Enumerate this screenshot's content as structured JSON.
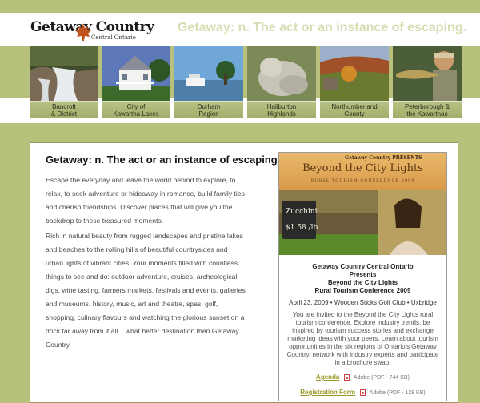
{
  "header": {
    "logo_name": "Getaway Country",
    "logo_sub": "Central Ontario",
    "tagline": "Getaway: n. The act or an instance of escaping."
  },
  "regions": [
    {
      "line1": "Bancroft",
      "line2": "& District"
    },
    {
      "line1": "City of",
      "line2": "Kawartha Lakes"
    },
    {
      "line1": "Durham",
      "line2": "Region"
    },
    {
      "line1": "Haliburton",
      "line2": "Highlands"
    },
    {
      "line1": "Northumberland",
      "line2": "County"
    },
    {
      "line1": "Peterborough &",
      "line2": "the Kawarthas"
    }
  ],
  "main": {
    "heading": "Getaway: n. The act or an instance of escaping.",
    "para1": "Escape the everyday and leave the world behind to explore, to relax, to seek adventure or hideaway in romance, build family ties and cherish friendships. Discover places that will give you the backdrop to these treasured moments.",
    "para2": "Rich in natural beauty from rugged landscapes and pristine lakes and beaches to the rolling hills of beautiful countrysides and urban lights of vibrant cities. Your moments filled with countless things to see and do: outdoor adventure, cruises, archeological digs, wine tasting, farmers markets, festivals and events, galleries and museums, history, music, art and theatre, spas, golf, shopping, culinary flavours and watching the glorious sunset on a dock far away from it all... what better destination then Getaway Country."
  },
  "promo": {
    "banner_logo": "Getaway Country",
    "banner_presents": "PRESENTS",
    "banner_title": "Beyond the City Lights",
    "banner_sub": "RURAL TOURISM CONFERENCE 2009",
    "photo_sign": "Zucchini",
    "photo_price": "$1.58 /lb",
    "title_lines": [
      "Getaway Country Central Ontario",
      "Presents",
      "Beyond the City Lights",
      "Rural Tourism Conference 2009"
    ],
    "meta": "April 23, 2009 • Wooden Sticks Golf Club • Uxbridge",
    "body": "You are invited to the Beyond the City Lights rural tourism conference. Explore industry trends, be inspired by tourism success stories and exchange marketing ideas with your peers. Learn about tourism opportunities in the six regions of Ontario's Getaway Country, network with industry experts and participate in a brochure swap.",
    "downloads": [
      {
        "label": "Agenda",
        "info": "Adobe (PDF - 744 KB)"
      },
      {
        "label": "Registration Form",
        "info": "Adobe (PDF - 128 KB)"
      }
    ]
  },
  "colors": {
    "band_green": "#b7c17c",
    "tagline": "#d8dcb2",
    "link": "#9a9a2a"
  }
}
